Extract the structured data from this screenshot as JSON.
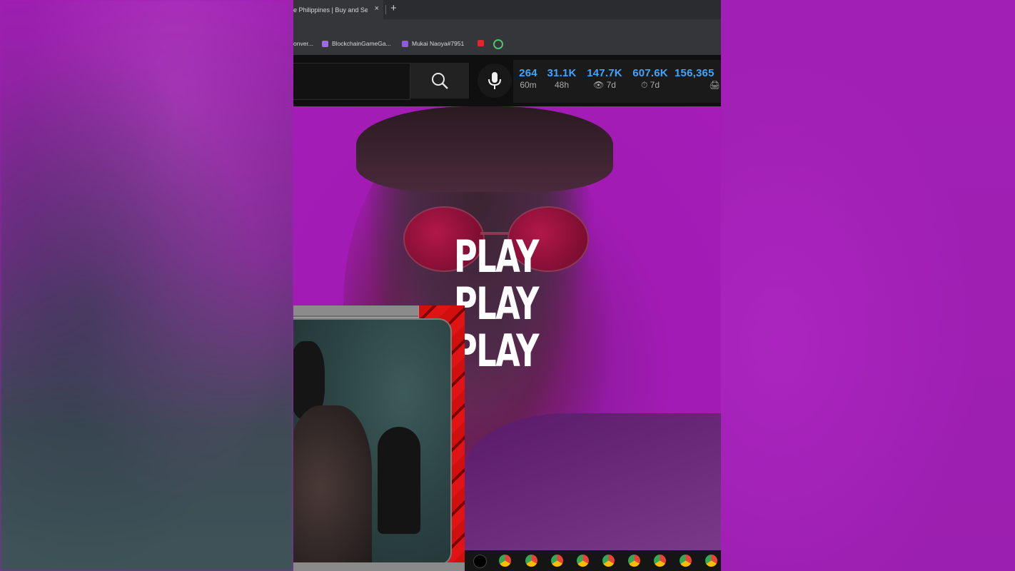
{
  "browser": {
    "tab_title": "e Philippines | Buy and Sel",
    "tab_close": "×",
    "new_tab": "+",
    "bookmarks": [
      {
        "label": "onver...",
        "color": ""
      },
      {
        "label": "BlockchainGameGa...",
        "color": "#9b6bdf"
      },
      {
        "label": "Mukai Naoya#7951",
        "color": "#8e5be0"
      }
    ]
  },
  "youtube": {
    "search_placeholder": "",
    "stats": [
      {
        "value": "264",
        "label": "60m"
      },
      {
        "value": "31.1K",
        "label": "48h"
      },
      {
        "value": "147.7K",
        "label": "👁 7d"
      },
      {
        "value": "607.6K",
        "label": "⏱ 7d"
      },
      {
        "value": "156,365",
        "label": "🖨"
      }
    ]
  },
  "artwork": {
    "lines": [
      "PLAY",
      "PLAY",
      "PLAY"
    ]
  },
  "colors": {
    "background": "#a11fb3",
    "accent_blue": "#3ea6ff",
    "overlay_red": "#d10f0f"
  },
  "taskbar": {
    "icons": [
      "tiktok-icon",
      "chrome-icon",
      "chrome-icon",
      "chrome-icon",
      "chrome-icon",
      "chrome-icon",
      "chrome-icon",
      "chrome-icon",
      "chrome-icon",
      "chrome-icon"
    ]
  }
}
